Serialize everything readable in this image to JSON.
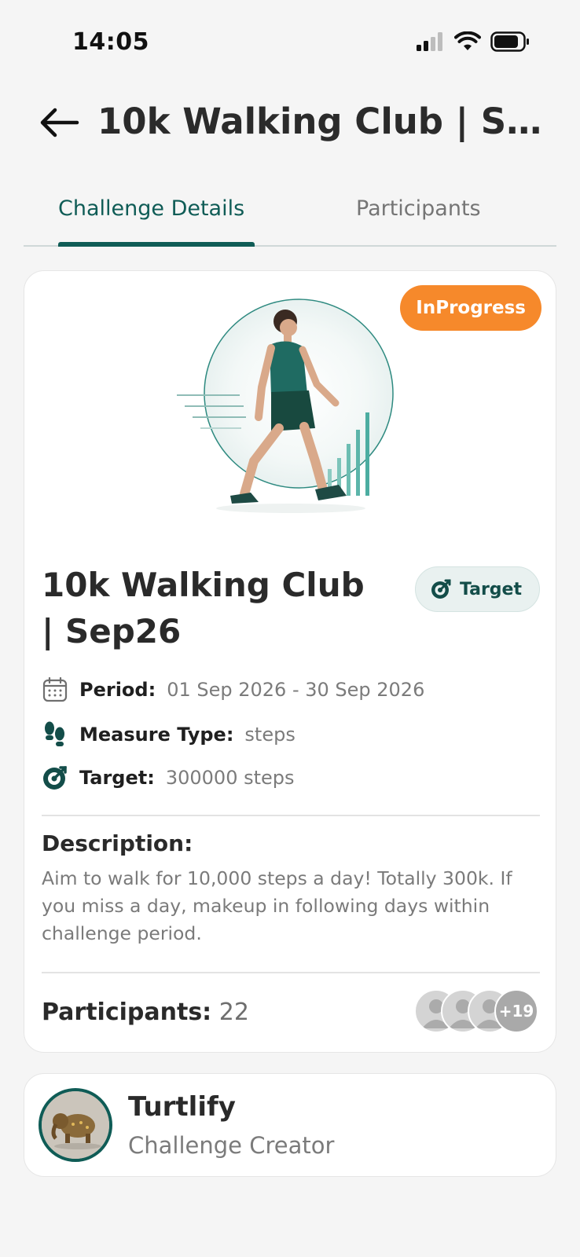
{
  "status_bar": {
    "time": "14:05",
    "icons": [
      "cellular-signal-icon",
      "wifi-icon",
      "battery-icon"
    ]
  },
  "header": {
    "back_icon": "arrow-left-icon",
    "title": "10k Walking Club | Sep..."
  },
  "tabs": [
    {
      "label": "Challenge Details",
      "active": true
    },
    {
      "label": "Participants",
      "active": false
    }
  ],
  "challenge": {
    "status": "InProgress",
    "title": "10k Walking Club | Sep26",
    "type_chip": "Target",
    "period": {
      "label": "Period:",
      "value": "01 Sep 2026 - 30 Sep 2026",
      "icon": "calendar-icon"
    },
    "measure_type": {
      "label": "Measure Type:",
      "value": "steps",
      "icon": "footsteps-icon"
    },
    "target": {
      "label": "Target:",
      "value": "300000 steps",
      "icon": "target-icon"
    },
    "description_label": "Description:",
    "description": "Aim to walk for 10,000 steps a day! Totally 300k. If you miss a day, makeup in following days within challenge period.",
    "participants_label": "Participants:",
    "participants_count": "22",
    "participants_more": "+19"
  },
  "creator": {
    "name": "Turtlify",
    "role": "Challenge Creator"
  },
  "colors": {
    "primary": "#0f5c56",
    "status_badge": "#f6892b",
    "background": "#f5f5f5",
    "card": "#ffffff"
  }
}
